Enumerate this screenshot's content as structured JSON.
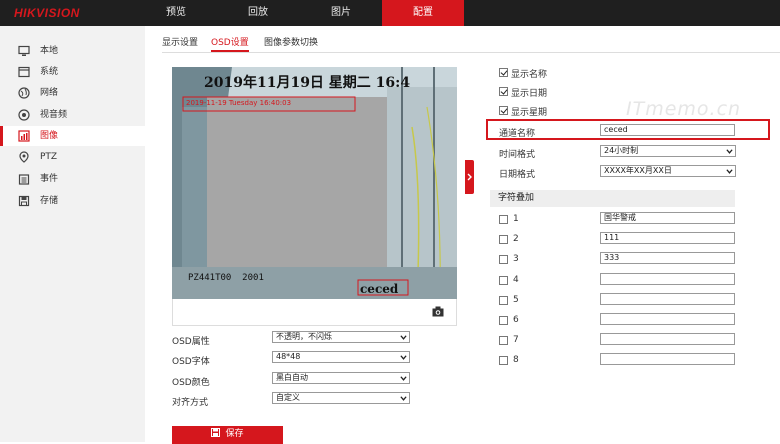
{
  "brand": "HIKVISION",
  "nav": [
    "预览",
    "回放",
    "图片",
    "配置"
  ],
  "sidebar": [
    {
      "label": "本地",
      "icon": "monitor-icon"
    },
    {
      "label": "系统",
      "icon": "system-icon"
    },
    {
      "label": "网络",
      "icon": "globe-icon"
    },
    {
      "label": "视音频",
      "icon": "audio-video-icon"
    },
    {
      "label": "图像",
      "icon": "image-icon"
    },
    {
      "label": "PTZ",
      "icon": "ptz-icon"
    },
    {
      "label": "事件",
      "icon": "calendar-icon"
    },
    {
      "label": "存储",
      "icon": "storage-icon"
    }
  ],
  "tabs": [
    "显示设置",
    "OSD设置",
    "图像参数切换"
  ],
  "video": {
    "date_overlay": "2019年11月19日  星期二  16:4",
    "small_overlay": "2019-11-19 Tuesday 16:40:03",
    "bottom_left_overlay": "PZ441T00  2001",
    "channel_overlay": "ceced"
  },
  "osd_form": [
    {
      "label": "OSD属性",
      "value": "不透明，不闪烁"
    },
    {
      "label": "OSD字体",
      "value": "48*48"
    },
    {
      "label": "OSD颜色",
      "value": "黑白自动"
    },
    {
      "label": "对齐方式",
      "value": "自定义"
    }
  ],
  "save_label": "保存",
  "display_checks": [
    "显示名称",
    "显示日期",
    "显示星期"
  ],
  "channel_name_label": "通道名称",
  "channel_name_value": "ceced",
  "time_format_label": "时间格式",
  "time_format_value": "24小时制",
  "date_format_label": "日期格式",
  "date_format_value": "XXXX年XX月XX日",
  "overlay_section": "字符叠加",
  "overlays": [
    {
      "n": "1",
      "value": "国华警戒"
    },
    {
      "n": "2",
      "value": "111"
    },
    {
      "n": "3",
      "value": "333"
    },
    {
      "n": "4",
      "value": ""
    },
    {
      "n": "5",
      "value": ""
    },
    {
      "n": "6",
      "value": ""
    },
    {
      "n": "7",
      "value": ""
    },
    {
      "n": "8",
      "value": ""
    }
  ],
  "watermark": "ITmemo.cn",
  "colors": {
    "accent": "#d5171d",
    "topbar": "#1f1f1f"
  }
}
